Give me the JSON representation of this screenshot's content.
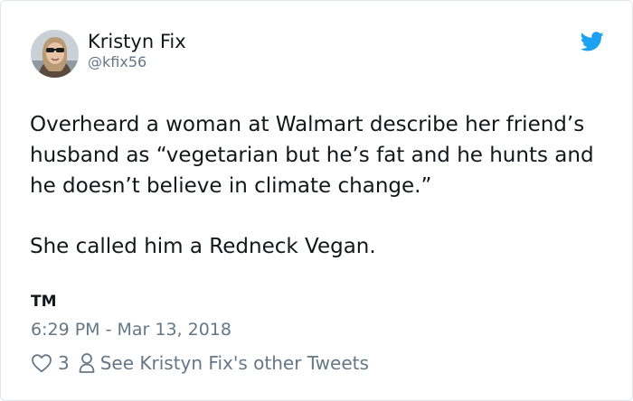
{
  "author": {
    "display_name": "Kristyn Fix",
    "handle": "@kfix56",
    "avatar_icon": "profile-photo"
  },
  "brand": {
    "icon": "twitter-bird-icon",
    "color": "#1da1f2"
  },
  "tweet": {
    "paragraphs": [
      "Overheard a woman at Walmart describe her friend’s husband as “vegetarian but he’s fat and he hunts and he doesn’t believe in climate change.”",
      "She called him a Redneck Vegan."
    ],
    "signature": "TM",
    "timestamp": "6:29 PM - Mar 13, 2018"
  },
  "actions": {
    "like_icon": "heart-outline-icon",
    "like_count": "3",
    "profile_icon": "person-icon",
    "other_tweets_label": "See Kristyn Fix's other Tweets"
  },
  "colors": {
    "text": "#14171a",
    "secondary": "#657786",
    "border": "#e1e8ed"
  }
}
